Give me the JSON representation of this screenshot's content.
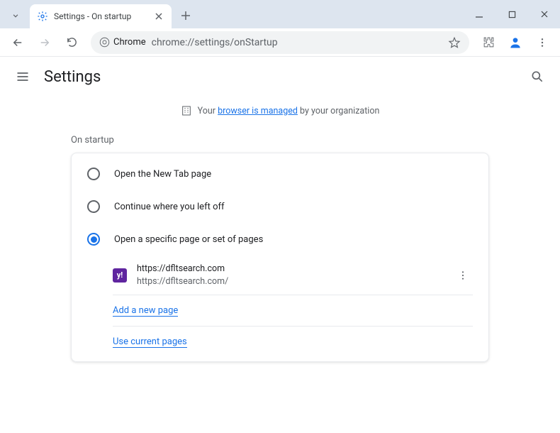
{
  "tab": {
    "title": "Settings - On startup"
  },
  "omnibox": {
    "chip": "Chrome",
    "url": "chrome://settings/onStartup"
  },
  "header": {
    "title": "Settings"
  },
  "managed": {
    "prefix": "Your ",
    "link": "browser is managed",
    "suffix": " by your organization"
  },
  "section": {
    "label": "On startup"
  },
  "radios": {
    "new_tab": "Open the New Tab page",
    "continue": "Continue where you left off",
    "specific": "Open a specific page or set of pages"
  },
  "page": {
    "icon_letter": "y!",
    "title": "https://dfltsearch.com",
    "url": "https://dfltsearch.com/"
  },
  "links": {
    "add": "Add a new page",
    "use_current": "Use current pages"
  }
}
